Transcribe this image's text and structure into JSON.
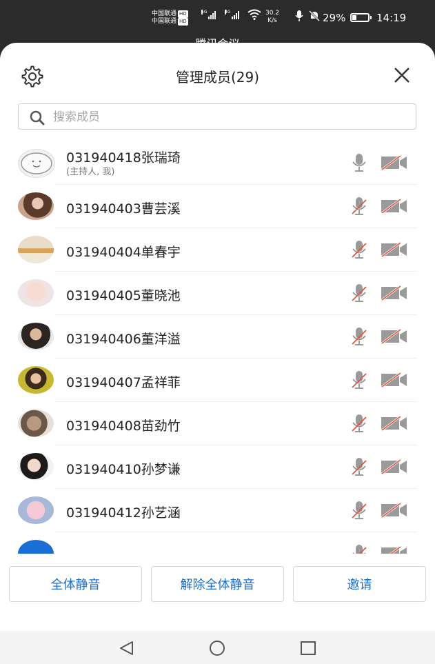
{
  "status_bar": {
    "carrier1": "中国联通",
    "carrier2": "中国联通",
    "hd": "HD",
    "net1": "5G",
    "net2": "4G",
    "speed_value": "30.2",
    "speed_unit": "K/s",
    "battery": "29%",
    "battery_level": 0.29,
    "time": "14:19"
  },
  "behind_title": "腾讯会议",
  "header": {
    "title": "管理成员(29)"
  },
  "search": {
    "placeholder": "搜索成员"
  },
  "members": [
    {
      "name": "031940418张瑞琦",
      "sub": "(主持人, 我)",
      "mic": "on",
      "camera": "off"
    },
    {
      "name": "031940403曹芸溪",
      "mic": "off",
      "camera": "off"
    },
    {
      "name": "031940404单春宇",
      "mic": "off",
      "camera": "off"
    },
    {
      "name": "031940405董晓池",
      "mic": "off",
      "camera": "off"
    },
    {
      "name": "031940406董洋溢",
      "mic": "off",
      "camera": "off"
    },
    {
      "name": "031940407孟祥菲",
      "mic": "off",
      "camera": "off"
    },
    {
      "name": "031940408苗劲竹",
      "mic": "off",
      "camera": "off"
    },
    {
      "name": "031940410孙梦谦",
      "mic": "off",
      "camera": "off"
    },
    {
      "name": "031940412孙艺涵",
      "mic": "off",
      "camera": "off"
    },
    {
      "name": "",
      "mic": "off",
      "camera": "off"
    }
  ],
  "footer": {
    "mute_all": "全体静音",
    "unmute_all": "解除全体静音",
    "invite": "邀请"
  },
  "colors": {
    "accent": "#1a6fd6",
    "muted_red": "#e0553c",
    "icon_gray": "#9a9a9a"
  }
}
